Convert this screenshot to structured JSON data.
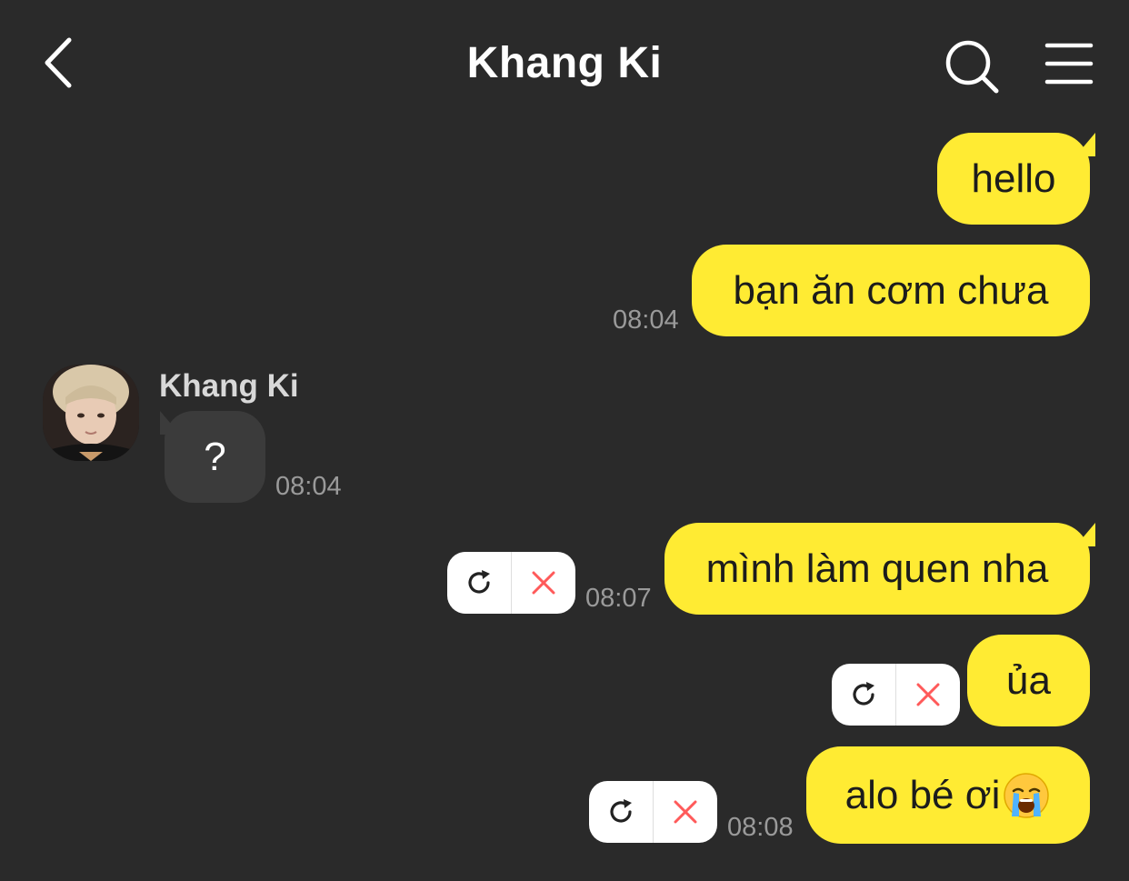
{
  "header": {
    "title": "Khang Ki",
    "icons": {
      "back": "chevron-left-icon",
      "search": "search-icon",
      "menu": "hamburger-menu-icon"
    }
  },
  "colors": {
    "background": "#2a2a2a",
    "outgoing_bubble": "#ffeb33",
    "incoming_bubble": "#3b3b3b",
    "timestamp": "#9a9a9a",
    "retry_action": "#222222",
    "delete_action": "#ff5a5a"
  },
  "messages": [
    {
      "direction": "outgoing",
      "text": "hello",
      "time": ""
    },
    {
      "direction": "outgoing",
      "text": "bạn ăn cơm chưa",
      "time": "08:04"
    },
    {
      "direction": "incoming",
      "sender": "Khang Ki",
      "text": "?",
      "time": "08:04"
    },
    {
      "direction": "outgoing",
      "text": "mình làm quen nha",
      "time": "08:07",
      "status": "failed"
    },
    {
      "direction": "outgoing",
      "text": "ủa",
      "time": "",
      "status": "failed"
    },
    {
      "direction": "outgoing",
      "text": "alo bé ơi",
      "emoji": "loudly-crying-face-icon",
      "time": "08:08",
      "status": "failed"
    }
  ]
}
